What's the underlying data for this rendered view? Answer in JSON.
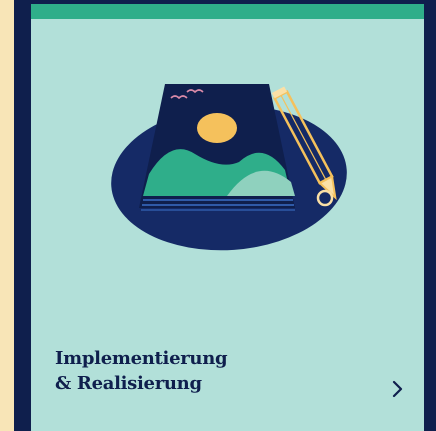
{
  "card": {
    "title_line1": "Implementierung",
    "title_line2": "& Realisierung",
    "icons": {
      "illustration": "landscape-picture-with-pencil-icon",
      "arrow": "chevron-right-icon"
    },
    "colors": {
      "background": "#b2e0d9",
      "accent_bar": "#2fae8a",
      "navy": "#0f1f4d",
      "side_peek": "#f8e5b7",
      "sun": "#f5c15c"
    }
  }
}
